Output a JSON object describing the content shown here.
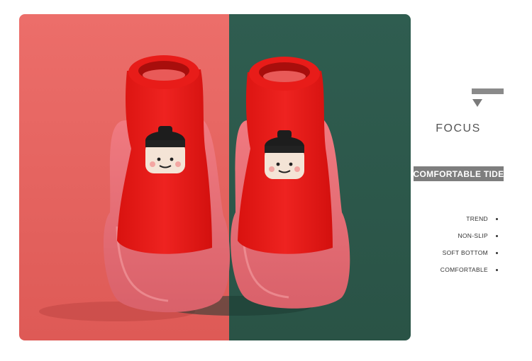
{
  "product": {
    "photo_subject": "red-sock-shoes",
    "colors": {
      "left_background": "#e4635f",
      "right_background": "#2e5a4d",
      "sock": "#e51a17",
      "sole": "#e26a70"
    }
  },
  "sidebar": {
    "focus_title": "FOCUS",
    "badge": "COMFORTABLE TIDE",
    "features": [
      {
        "label": "TREND"
      },
      {
        "label": "NON-SLIP"
      },
      {
        "label": "SOFT BOTTOM"
      },
      {
        "label": "COMFORTABLE"
      }
    ]
  }
}
